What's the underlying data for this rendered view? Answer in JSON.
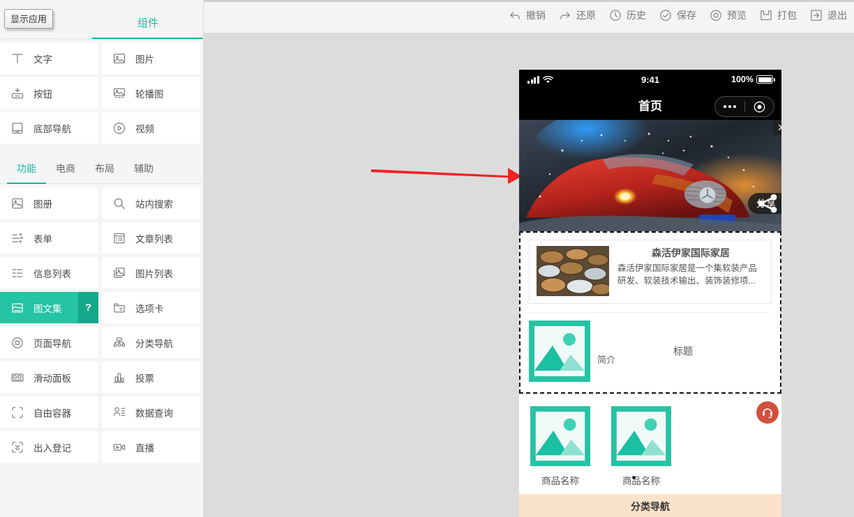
{
  "window": {
    "show_app_button": "显示应用"
  },
  "sidebar": {
    "tab_label": "组件",
    "basic_components": [
      {
        "label": "文字",
        "icon": "text-icon"
      },
      {
        "label": "图片",
        "icon": "image-icon"
      },
      {
        "label": "按钮",
        "icon": "button-icon"
      },
      {
        "label": "轮播图",
        "icon": "carousel-icon"
      },
      {
        "label": "底部导航",
        "icon": "bottom-nav-icon"
      },
      {
        "label": "视频",
        "icon": "video-icon"
      }
    ],
    "category_tabs": [
      {
        "label": "功能",
        "active": true
      },
      {
        "label": "电商",
        "active": false
      },
      {
        "label": "布局",
        "active": false
      },
      {
        "label": "辅助",
        "active": false
      }
    ],
    "function_components": [
      {
        "label": "图册",
        "icon": "album-icon",
        "selected": false
      },
      {
        "label": "站内搜索",
        "icon": "search-icon",
        "selected": false
      },
      {
        "label": "表单",
        "icon": "form-icon",
        "selected": false
      },
      {
        "label": "文章列表",
        "icon": "article-list-icon",
        "selected": false
      },
      {
        "label": "信息列表",
        "icon": "info-list-icon",
        "selected": false
      },
      {
        "label": "图片列表",
        "icon": "image-list-icon",
        "selected": false
      },
      {
        "label": "图文集",
        "icon": "image-text-icon",
        "selected": true,
        "help": "?"
      },
      {
        "label": "选项卡",
        "icon": "tab-card-icon",
        "selected": false
      },
      {
        "label": "页面导航",
        "icon": "page-nav-icon",
        "selected": false
      },
      {
        "label": "分类导航",
        "icon": "category-nav-icon",
        "selected": false
      },
      {
        "label": "滑动面板",
        "icon": "slide-panel-icon",
        "selected": false
      },
      {
        "label": "投票",
        "icon": "vote-icon",
        "selected": false
      },
      {
        "label": "自由容器",
        "icon": "free-container-icon",
        "selected": false
      },
      {
        "label": "数据查询",
        "icon": "data-query-icon",
        "selected": false
      },
      {
        "label": "出入登记",
        "icon": "entry-register-icon",
        "selected": false
      },
      {
        "label": "直播",
        "icon": "live-icon",
        "selected": false
      }
    ]
  },
  "toolbar": {
    "items": [
      {
        "label": "撤销",
        "icon": "undo-icon"
      },
      {
        "label": "还原",
        "icon": "redo-icon"
      },
      {
        "label": "历史",
        "icon": "history-clock-icon"
      },
      {
        "label": "保存",
        "icon": "save-check-icon"
      },
      {
        "label": "预览",
        "icon": "preview-eye-icon"
      },
      {
        "label": "打包",
        "icon": "package-icon"
      },
      {
        "label": "退出",
        "icon": "exit-icon"
      }
    ]
  },
  "preview": {
    "status_bar": {
      "time": "9:41",
      "battery_text": "100%",
      "signal_icon": "signal-bars-icon",
      "wifi_icon": "wifi-icon",
      "battery_icon": "battery-full-icon"
    },
    "nav": {
      "title": "首页",
      "capsule_more_icon": "more-dots-icon",
      "capsule_target_icon": "target-circle-icon"
    },
    "banner": {
      "close_label": "✕",
      "share_label": "分享",
      "share_icon": "share-icon",
      "alt": "红色跑车特效图"
    },
    "news_card": {
      "title": "森活伊家国际家居",
      "desc": "森活伊家国际家居是一个集软装产品研发、软装技术输出、装饰装修项...",
      "thumb_alt": "硬币堆图片"
    },
    "image_text": {
      "title": "标题",
      "subtitle": "简介",
      "placeholder_icon": "image-placeholder-icon"
    },
    "goods": [
      {
        "name": "商品名称",
        "placeholder_icon": "image-placeholder-icon"
      },
      {
        "name": "商品名称",
        "placeholder_icon": "image-placeholder-icon"
      }
    ],
    "category_nav_label": "分类导航",
    "service_fab_icon": "customer-service-icon"
  },
  "annotation": {
    "arrow_color": "#f22222",
    "arrow_icon": "red-arrow-right-icon"
  },
  "colors": {
    "accent": "#1abc9c",
    "selected": "#25c4a2",
    "help_badge": "#14a98b",
    "canvas_bg": "#dcdcdc",
    "category_nav_bg": "#fbe2cb",
    "fab": "#d1503c"
  }
}
